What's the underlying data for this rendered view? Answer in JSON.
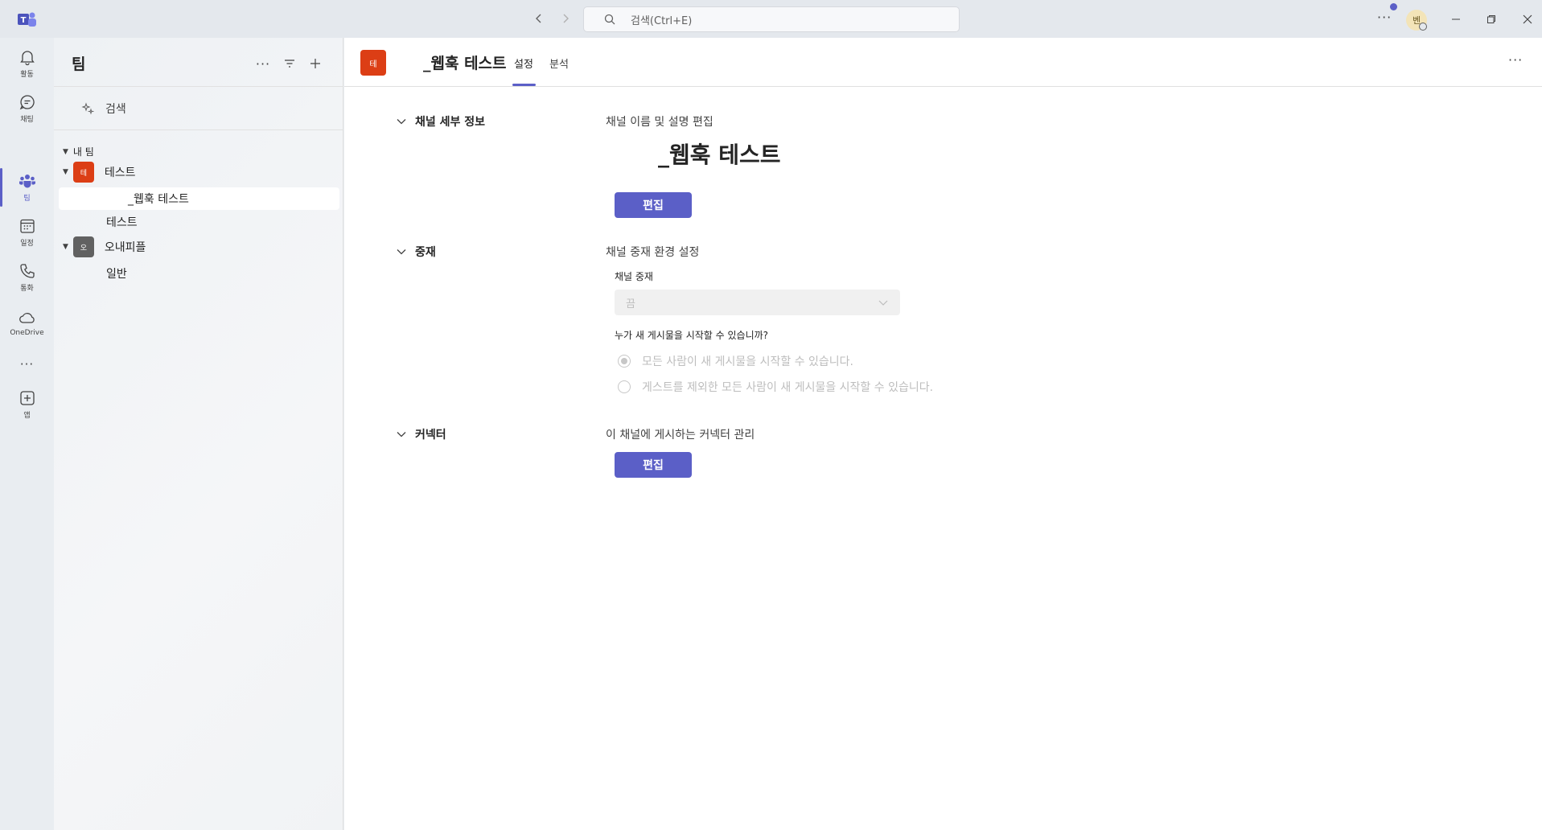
{
  "titlebar": {
    "search_placeholder": "검색(Ctrl+E)",
    "more": "···",
    "avatar_initial": "벤"
  },
  "rail": {
    "items": [
      {
        "label": "활동",
        "icon": "bell-icon"
      },
      {
        "label": "채팅",
        "icon": "chat-icon"
      },
      {
        "label": "팀",
        "icon": "teams-icon"
      },
      {
        "label": "일정",
        "icon": "calendar-icon"
      },
      {
        "label": "통화",
        "icon": "phone-icon"
      },
      {
        "label": "OneDrive",
        "icon": "cloud-icon"
      },
      {
        "label": "",
        "icon": "more-icon"
      },
      {
        "label": "앱",
        "icon": "add-app-icon"
      }
    ],
    "more": "···"
  },
  "panel": {
    "title": "팀",
    "search_label": "검색",
    "my_teams_label": "내 팀",
    "teams": [
      {
        "initial": "테",
        "name": "테스트",
        "color": "#dc3e15",
        "channels": [
          "_웹훅 테스트",
          "테스트"
        ]
      },
      {
        "initial": "오",
        "name": "오내피플",
        "color": "#616161",
        "channels": [
          "일반"
        ]
      }
    ]
  },
  "header": {
    "avatar_initial": "테",
    "channel_title": "_웹훅 테스트",
    "tabs": [
      {
        "label": "설정",
        "active": true
      },
      {
        "label": "분석",
        "active": false
      }
    ],
    "more": "···"
  },
  "sections": {
    "details": {
      "title": "채널 세부 정보",
      "desc": "채널 이름 및 설명 편집",
      "channel_name": "_웹훅 테스트",
      "button": "편집"
    },
    "moderation": {
      "title": "중재",
      "desc": "채널 중재 환경 설정",
      "field_label": "채널 중재",
      "dropdown_value": "끔",
      "question": "누가 새 게시물을 시작할 수 있습니까?",
      "options": [
        {
          "label": "모든 사람이 새 게시물을 시작할 수 있습니다.",
          "selected": true
        },
        {
          "label": "게스트를 제외한 모든 사람이 새 게시물을 시작할 수 있습니다.",
          "selected": false
        }
      ]
    },
    "connectors": {
      "title": "커넥터",
      "desc": "이 채널에 게시하는 커넥터 관리",
      "button": "편집"
    }
  },
  "colors": {
    "accent": "#5b5fc7",
    "team_red": "#dc3e15"
  }
}
